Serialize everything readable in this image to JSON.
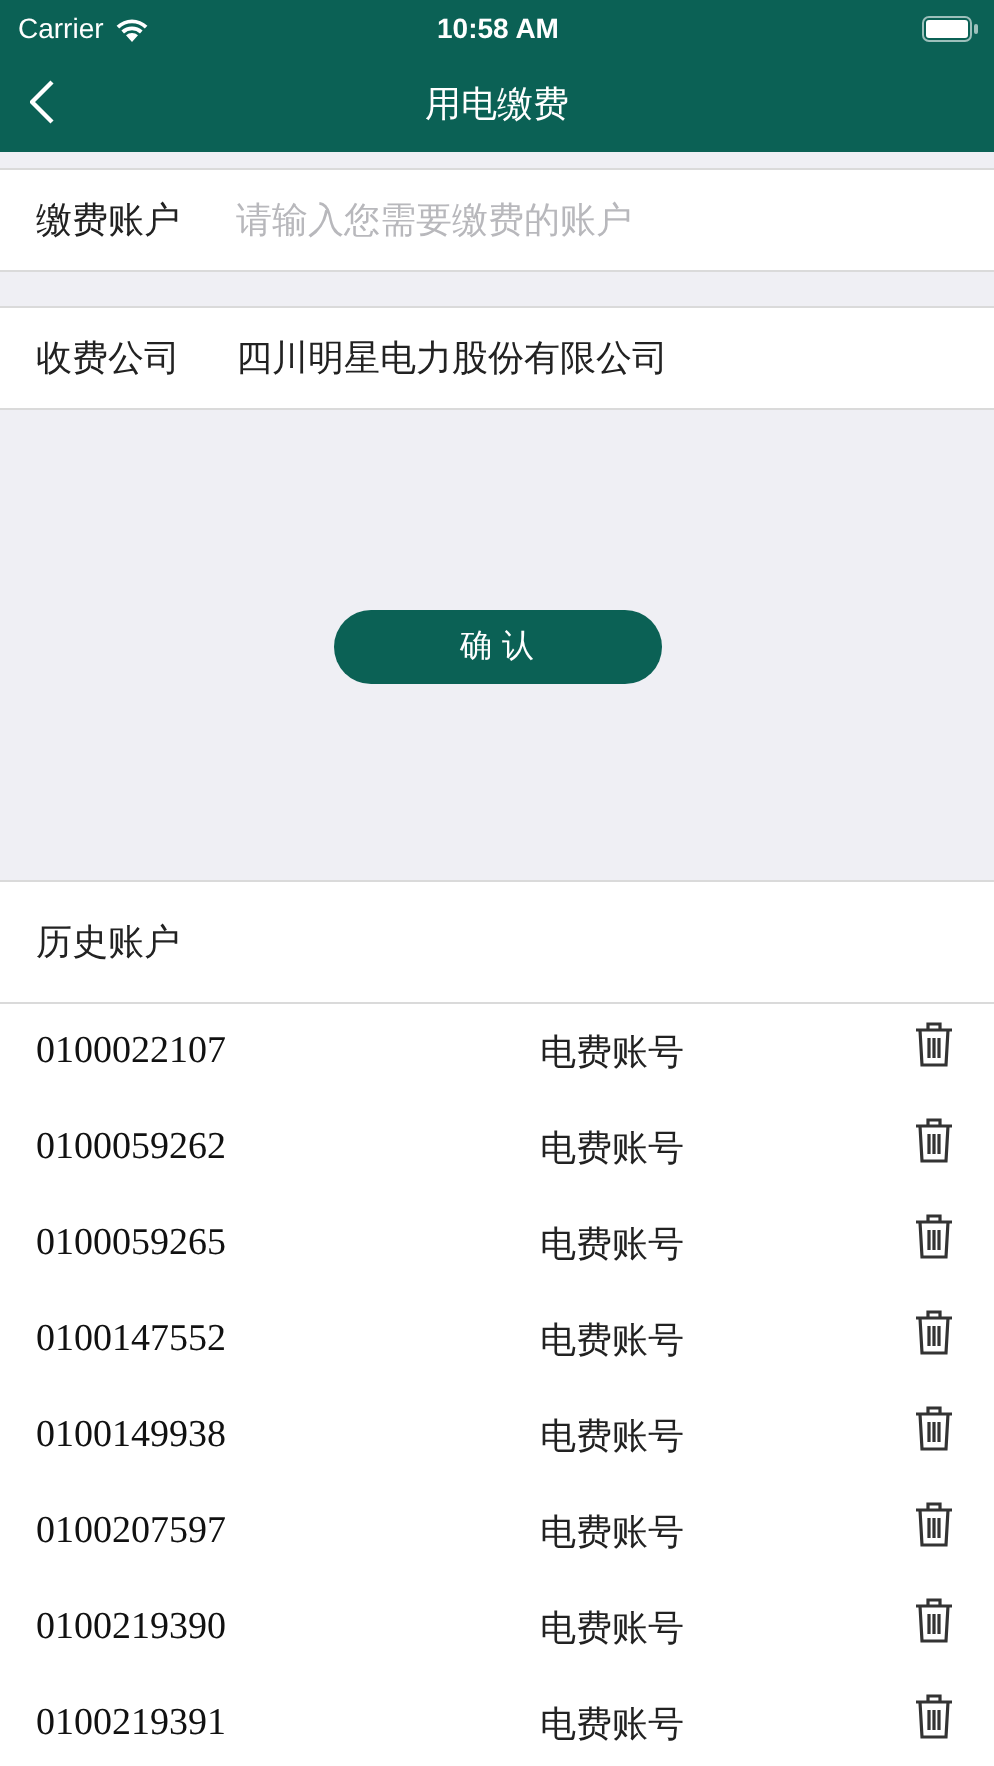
{
  "status_bar": {
    "carrier": "Carrier",
    "time": "10:58 AM"
  },
  "nav": {
    "title": "用电缴费"
  },
  "account_field": {
    "label": "缴费账户",
    "placeholder": "请输入您需要缴费的账户"
  },
  "company": {
    "label": "收费公司",
    "value": "四川明星电力股份有限公司"
  },
  "confirm_button": "确 认",
  "history": {
    "title": "历史账户",
    "rows": [
      {
        "number": "0100022107",
        "type": "电费账号"
      },
      {
        "number": "0100059262",
        "type": "电费账号"
      },
      {
        "number": "0100059265",
        "type": "电费账号"
      },
      {
        "number": "0100147552",
        "type": "电费账号"
      },
      {
        "number": "0100149938",
        "type": "电费账号"
      },
      {
        "number": "0100207597",
        "type": "电费账号"
      },
      {
        "number": "0100219390",
        "type": "电费账号"
      },
      {
        "number": "0100219391",
        "type": "电费账号"
      }
    ]
  }
}
